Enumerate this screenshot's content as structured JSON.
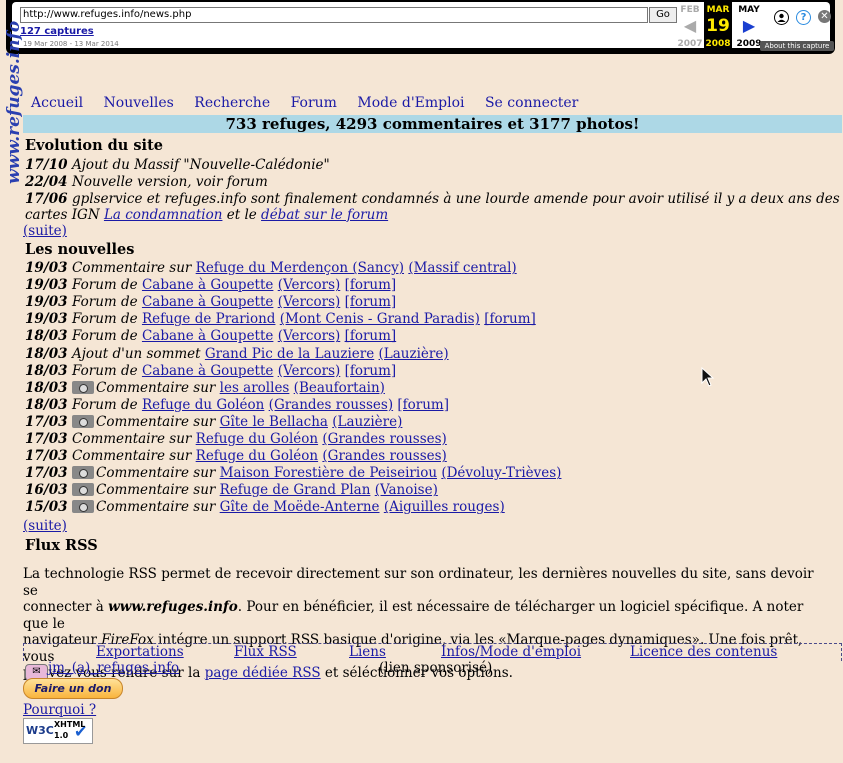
{
  "wayback": {
    "url": "http://www.refuges.info/news.php",
    "go_label": "Go",
    "captures": "127 captures",
    "range": "19 Mar 2008 - 13 Mar 2014",
    "prev_month": "FEB",
    "prev_year": "2007",
    "cur_month": "MAR",
    "cur_day": "19",
    "cur_year": "2008",
    "next_month": "MAY",
    "next_year": "2009",
    "about": "About this capture",
    "help_symbol": "?",
    "close_symbol": "✕"
  },
  "logo": "www.refuges.info",
  "nav": [
    "Accueil",
    "Nouvelles",
    "Recherche",
    "Forum",
    "Mode d'Emploi",
    "Se connecter"
  ],
  "banner": "733 refuges, 4293 commentaires et 3177 photos!",
  "evolution": {
    "title": "Evolution du site",
    "items": [
      {
        "date": "17/10",
        "text": "Ajout du Massif \"Nouvelle-Calédonie\""
      },
      {
        "date": "22/04",
        "text": "Nouvelle version, voir forum"
      }
    ],
    "long_item": {
      "date": "17/06",
      "text1": "gplservice et refuges.info sont finalement condamnés à une lourde amende pour avoir utilisé il y a deux ans des",
      "text2": "cartes IGN",
      "link1": "La condamnation",
      "mid": "et le",
      "link2": "débat sur le forum"
    },
    "more": "(suite)"
  },
  "news": {
    "title": "Les nouvelles",
    "items": [
      {
        "date": "19/03",
        "photo": false,
        "verb": "Commentaire sur",
        "place": "Refuge du Merdençon (Sancy)",
        "massif": "(Massif central)",
        "forum": ""
      },
      {
        "date": "19/03",
        "photo": false,
        "verb": "Forum de",
        "place": "Cabane à Goupette",
        "massif": "(Vercors)",
        "forum": "[forum]"
      },
      {
        "date": "19/03",
        "photo": false,
        "verb": "Forum de",
        "place": "Cabane à Goupette",
        "massif": "(Vercors)",
        "forum": "[forum]"
      },
      {
        "date": "19/03",
        "photo": false,
        "verb": "Forum de",
        "place": "Refuge de Prariond",
        "massif": "(Mont Cenis - Grand Paradis)",
        "forum": "[forum]"
      },
      {
        "date": "18/03",
        "photo": false,
        "verb": "Forum de",
        "place": "Cabane à Goupette",
        "massif": "(Vercors)",
        "forum": "[forum]"
      },
      {
        "date": "18/03",
        "photo": false,
        "verb": "Ajout d'un sommet",
        "place": "Grand Pic de la Lauziere",
        "massif": "(Lauzière)",
        "forum": ""
      },
      {
        "date": "18/03",
        "photo": false,
        "verb": "Forum de",
        "place": "Cabane à Goupette",
        "massif": "(Vercors)",
        "forum": "[forum]"
      },
      {
        "date": "18/03",
        "photo": true,
        "verb": "Commentaire sur",
        "place": "les arolles",
        "massif": "(Beaufortain)",
        "forum": ""
      },
      {
        "date": "18/03",
        "photo": false,
        "verb": "Forum de",
        "place": "Refuge du Goléon",
        "massif": "(Grandes rousses)",
        "forum": "[forum]"
      },
      {
        "date": "17/03",
        "photo": true,
        "verb": "Commentaire sur",
        "place": "Gîte le Bellacha",
        "massif": "(Lauzière)",
        "forum": ""
      },
      {
        "date": "17/03",
        "photo": false,
        "verb": "Commentaire sur",
        "place": "Refuge du Goléon",
        "massif": "(Grandes rousses)",
        "forum": ""
      },
      {
        "date": "17/03",
        "photo": false,
        "verb": "Commentaire sur",
        "place": "Refuge du Goléon",
        "massif": "(Grandes rousses)",
        "forum": ""
      },
      {
        "date": "17/03",
        "photo": true,
        "verb": "Commentaire sur",
        "place": "Maison Forestière de Peiseiriou",
        "massif": "(Dévoluy-Trièves)",
        "forum": ""
      },
      {
        "date": "16/03",
        "photo": true,
        "verb": "Commentaire sur",
        "place": "Refuge de Grand Plan",
        "massif": "(Vanoise)",
        "forum": ""
      },
      {
        "date": "15/03",
        "photo": true,
        "verb": "Commentaire sur",
        "place": "Gîte de Moëde-Anterne",
        "massif": "(Aiguilles rouges)",
        "forum": ""
      }
    ],
    "more": "(suite)"
  },
  "rss": {
    "title": "Flux RSS",
    "l1a": "La technologie RSS permet de recevoir directement sur son ordinateur, les dernières nouvelles du site, sans devoir se",
    "l2a": "connecter à",
    "site": "www.refuges.info",
    "l2b": ". Pour en bénéficier, il est nécessaire de télécharger un logiciel spécifique. A noter que le",
    "l3a": "navigateur",
    "ff": "FireFox",
    "l3b": "intégre un support RSS basique d'origine, via les «Marque-pages dynamiques». Une fois prêt, vous",
    "l4a": "pouvez vous rendre sur la",
    "link": "page dédiée RSS",
    "l4b": "et séléctionner vos options."
  },
  "footer": {
    "links": [
      "Exportations",
      "Flux RSS",
      "Liens",
      "Infos/Mode d'emploi",
      "Licence des contenus"
    ],
    "mail": "jm_(a)_refuges.info",
    "sponsor": "(lien sponsorisé)",
    "donate": "Faire un don",
    "why": "Pourquoi ?",
    "w3c": "W3C",
    "xhtml": "XHTML",
    "xhtml_ver": "1.0"
  }
}
